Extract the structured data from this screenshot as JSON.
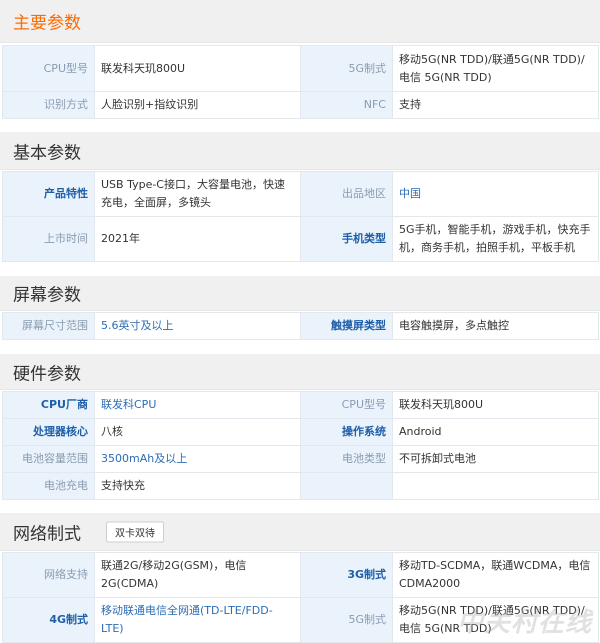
{
  "sections": {
    "main": {
      "title": "主要参数",
      "rows": [
        {
          "l1": "CPU型号",
          "v1": "联发科天玑800U",
          "l2": "5G制式",
          "v2": "移动5G(NR TDD)/联通5G(NR TDD)/电信 5G(NR TDD)"
        },
        {
          "l1": "识别方式",
          "v1": "人脸识别+指纹识别",
          "l2": "NFC",
          "v2": "支持"
        }
      ]
    },
    "basic": {
      "title": "基本参数",
      "rows": [
        {
          "l1": "产品特性",
          "v1": "USB Type-C接口，大容量电池，快速充电，全面屏，多镜头",
          "l2": "出品地区",
          "v2": "中国"
        },
        {
          "l1": "上市时间",
          "v1": "2021年",
          "l2": "手机类型",
          "v2": "5G手机，智能手机，游戏手机，快充手机，商务手机，拍照手机，平板手机"
        }
      ]
    },
    "screen": {
      "title": "屏幕参数",
      "rows": [
        {
          "l1": "屏幕尺寸范围",
          "v1": "5.6英寸及以上",
          "l2": "触摸屏类型",
          "v2": "电容触摸屏，多点触控"
        }
      ]
    },
    "hardware": {
      "title": "硬件参数",
      "rows": [
        {
          "l1": "CPU厂商",
          "v1": "联发科CPU",
          "l2": "CPU型号",
          "v2": "联发科天玑800U"
        },
        {
          "l1": "处理器核心",
          "v1": "八核",
          "l2": "操作系统",
          "v2": "Android"
        },
        {
          "l1": "电池容量范围",
          "v1": "3500mAh及以上",
          "l2": "电池类型",
          "v2": "不可拆卸式电池"
        },
        {
          "l1": "电池充电",
          "v1": "支持快充",
          "l2": "",
          "v2": ""
        }
      ]
    },
    "network": {
      "title": "网络制式",
      "badge": "双卡双待",
      "rows": [
        {
          "l1": "网络支持",
          "v1": "联通2G/移动2G(GSM)，电信2G(CDMA)",
          "l2": "3G制式",
          "v2": "移动TD-SCDMA，联通WCDMA，电信CDMA2000"
        },
        {
          "l1": "4G制式",
          "v1": "移动联通电信全网通(TD-LTE/FDD-LTE)",
          "l2": "5G制式",
          "v2": "移动5G(NR TDD)/联通5G(NR TDD)/电信 5G(NR TDD)"
        }
      ]
    }
  },
  "watermark": "中关村在线"
}
